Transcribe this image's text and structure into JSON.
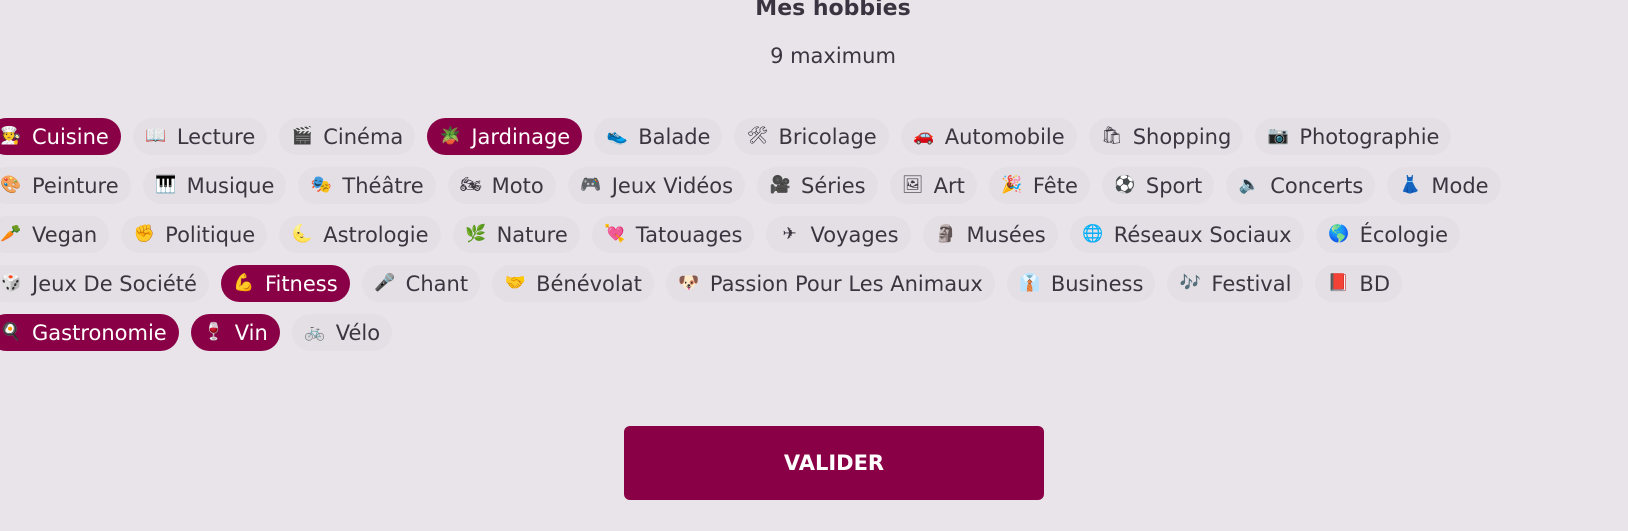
{
  "header": {
    "title": "Mes hobbies",
    "subtitle": "9 maximum"
  },
  "rows": [
    [
      {
        "label": "Cuisine",
        "icon": "🧑‍🍳",
        "icon_name": "cook-icon",
        "selected": true
      },
      {
        "label": "Lecture",
        "icon": "📖",
        "icon_name": "book-icon",
        "selected": false
      },
      {
        "label": "Cinéma",
        "icon": "🎬",
        "icon_name": "clapper-icon",
        "selected": false
      },
      {
        "label": "Jardinage",
        "icon": "🪴",
        "icon_name": "potted-plant-icon",
        "selected": true
      },
      {
        "label": "Balade",
        "icon": "👟",
        "icon_name": "shoe-icon",
        "selected": false
      },
      {
        "label": "Bricolage",
        "icon": "🛠",
        "icon_name": "tools-icon",
        "selected": false
      },
      {
        "label": "Automobile",
        "icon": "🚗",
        "icon_name": "car-icon",
        "selected": false
      },
      {
        "label": "Shopping",
        "icon": "🛍",
        "icon_name": "shopping-bags-icon",
        "selected": false
      },
      {
        "label": "Photographie",
        "icon": "📷",
        "icon_name": "camera-icon",
        "selected": false
      }
    ],
    [
      {
        "label": "Peinture",
        "icon": "🎨",
        "icon_name": "palette-icon",
        "selected": false
      },
      {
        "label": "Musique",
        "icon": "🎹",
        "icon_name": "piano-icon",
        "selected": false
      },
      {
        "label": "Théâtre",
        "icon": "🎭",
        "icon_name": "theater-masks-icon",
        "selected": false
      },
      {
        "label": "Moto",
        "icon": "🏍",
        "icon_name": "motorcycle-icon",
        "selected": false
      },
      {
        "label": "Jeux Vidéos",
        "icon": "🎮",
        "icon_name": "gamepad-icon",
        "selected": false
      },
      {
        "label": "Séries",
        "icon": "🎥",
        "icon_name": "movie-camera-icon",
        "selected": false
      },
      {
        "label": "Art",
        "icon": "🖼",
        "icon_name": "framed-picture-icon",
        "selected": false
      },
      {
        "label": "Fête",
        "icon": "🎉",
        "icon_name": "party-popper-icon",
        "selected": false
      },
      {
        "label": "Sport",
        "icon": "⚽",
        "icon_name": "soccer-ball-icon",
        "selected": false
      },
      {
        "label": "Concerts",
        "icon": "🔈",
        "icon_name": "speaker-icon",
        "selected": false
      },
      {
        "label": "Mode",
        "icon": "👗",
        "icon_name": "dress-icon",
        "selected": false
      }
    ],
    [
      {
        "label": "Vegan",
        "icon": "🥕",
        "icon_name": "carrot-icon",
        "selected": false
      },
      {
        "label": "Politique",
        "icon": "✊",
        "icon_name": "raised-fist-icon",
        "selected": false
      },
      {
        "label": "Astrologie",
        "icon": "🌜",
        "icon_name": "moon-icon",
        "selected": false
      },
      {
        "label": "Nature",
        "icon": "🌿",
        "icon_name": "herb-icon",
        "selected": false
      },
      {
        "label": "Tatouages",
        "icon": "💘",
        "icon_name": "heart-arrow-icon",
        "selected": false
      },
      {
        "label": "Voyages",
        "icon": "✈",
        "icon_name": "airplane-icon",
        "selected": false
      },
      {
        "label": "Musées",
        "icon": "🗿",
        "icon_name": "statue-icon",
        "selected": false
      },
      {
        "label": "Réseaux Sociaux",
        "icon": "🌐",
        "icon_name": "globe-icon",
        "selected": false
      },
      {
        "label": "Écologie",
        "icon": "🌎",
        "icon_name": "earth-icon",
        "selected": false
      }
    ],
    [
      {
        "label": "Jeux De Société",
        "icon": "🎲",
        "icon_name": "dice-icon",
        "selected": false
      },
      {
        "label": "Fitness",
        "icon": "💪",
        "icon_name": "flexed-biceps-icon",
        "selected": true
      },
      {
        "label": "Chant",
        "icon": "🎤",
        "icon_name": "microphone-icon",
        "selected": false
      },
      {
        "label": "Bénévolat",
        "icon": "🤝",
        "icon_name": "handshake-icon",
        "selected": false
      },
      {
        "label": "Passion Pour Les Animaux",
        "icon": "🐶",
        "icon_name": "dog-icon",
        "selected": false
      },
      {
        "label": "Business",
        "icon": "👔",
        "icon_name": "necktie-icon",
        "selected": false
      },
      {
        "label": "Festival",
        "icon": "🎶",
        "icon_name": "music-notes-icon",
        "selected": false
      },
      {
        "label": "BD",
        "icon": "📕",
        "icon_name": "book-red-icon",
        "selected": false
      }
    ],
    [
      {
        "label": "Gastronomie",
        "icon": "🍳",
        "icon_name": "cooking-pan-icon",
        "selected": true
      },
      {
        "label": "Vin",
        "icon": "🍷",
        "icon_name": "wine-glass-icon",
        "selected": true
      },
      {
        "label": "Vélo",
        "icon": "🚲",
        "icon_name": "bicycle-icon",
        "selected": false
      }
    ]
  ],
  "actions": {
    "submit_label": "VALIDER"
  },
  "colors": {
    "accent": "#8a0046",
    "chip_bg": "#e3dfe5",
    "page_bg": "#e8e4ea"
  }
}
